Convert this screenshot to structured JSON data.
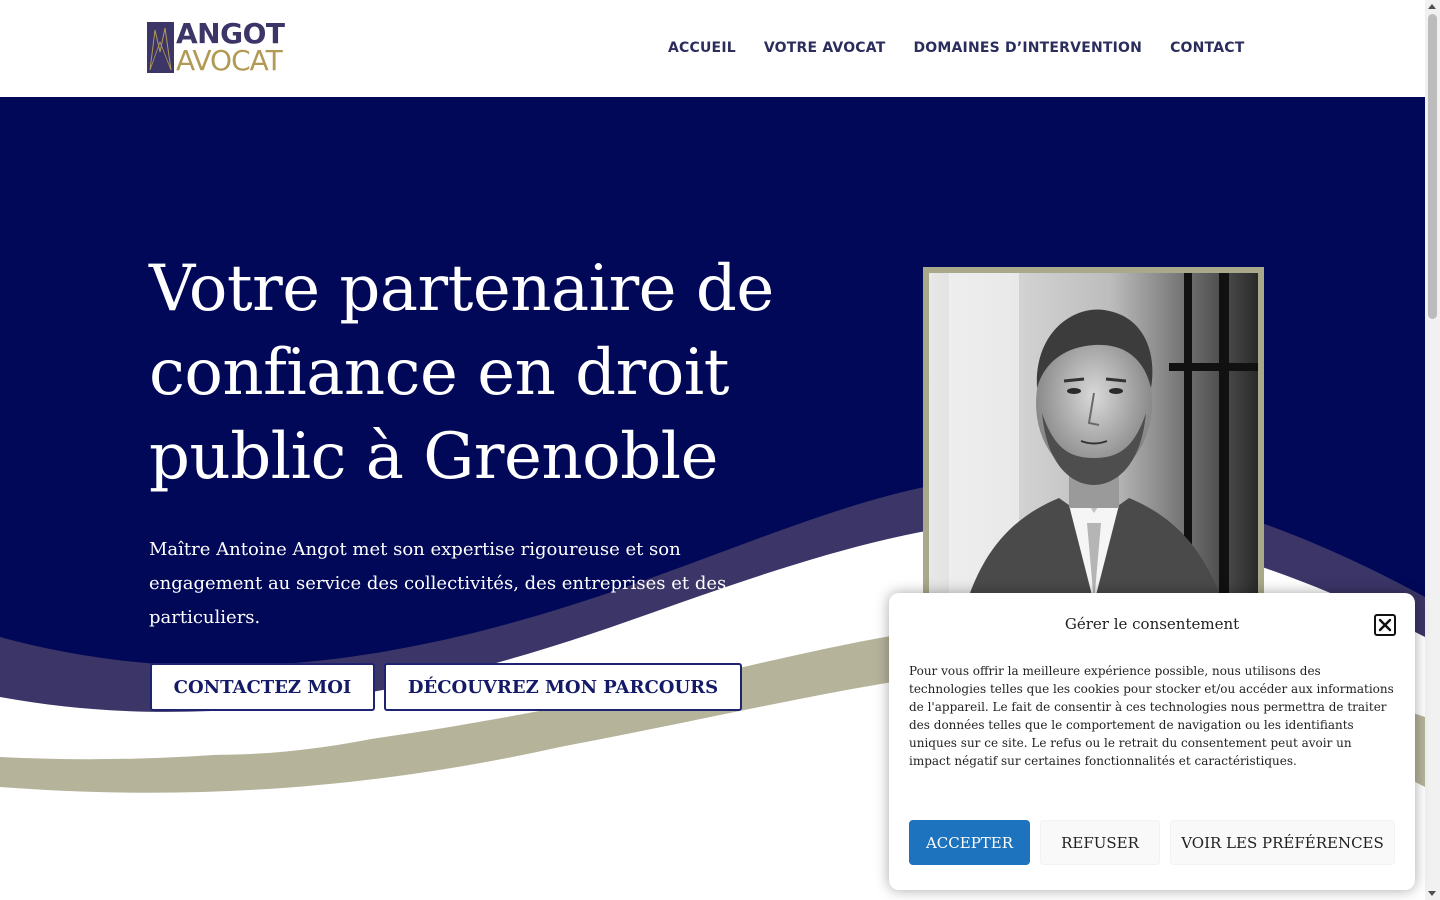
{
  "header": {
    "logo_top": "ANGOT",
    "logo_bottom": "AVOCAT",
    "nav": [
      {
        "label": "ACCUEIL"
      },
      {
        "label": "VOTRE AVOCAT"
      },
      {
        "label": "DOMAINES D’INTERVENTION"
      },
      {
        "label": "CONTACT"
      }
    ]
  },
  "hero": {
    "title": "Votre partenaire de confiance en droit public à Grenoble",
    "subtitle": "Maître Antoine Angot met son expertise rigoureuse et son engagement au service des collectivités, des entreprises et des particuliers.",
    "buttons": {
      "contact": "CONTACTEZ MOI",
      "parcours": "DÉCOUVREZ MON PARCOURS"
    },
    "portrait_icon": "lawyer-portrait-photo"
  },
  "consent": {
    "title": "Gérer le consentement",
    "text": "Pour vous offrir la meilleure expérience possible, nous utilisons des technologies telles que les cookies pour stocker et/ou accéder aux informations de l'appareil. Le fait de consentir à ces technologies nous permettra de traiter des données telles que le comportement de navigation ou les identifiants uniques sur ce site. Le refus ou le retrait du consentement peut avoir un impact négatif sur certaines fonctionnalités et caractéristiques.",
    "accept": "ACCEPTER",
    "refuse": "REFUSER",
    "prefs": "VOIR LES PRÉFÉRENCES"
  },
  "colors": {
    "navy": "#010857",
    "wave_purple": "#3b3568",
    "wave_beige": "#b6b39b",
    "gold": "#b29a55",
    "accept_blue": "#1e73be"
  }
}
